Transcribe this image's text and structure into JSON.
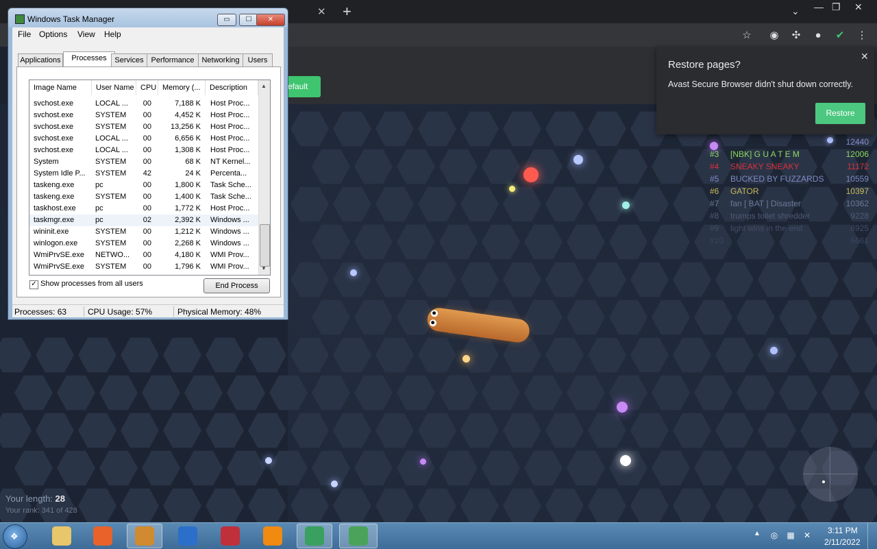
{
  "browser": {
    "tab_close": "✕",
    "new_tab": "+",
    "window_controls": [
      "—",
      "❐",
      "✕"
    ],
    "toolbar_icons": [
      "star-icon",
      "avast-icon",
      "puzzle-icon",
      "profile-icon",
      "shield-check-icon",
      "more-icon"
    ],
    "default_button_label": "efault"
  },
  "restore_popup": {
    "title": "Restore pages?",
    "message": "Avast Secure Browser didn't shut down correctly.",
    "button": "Restore",
    "close": "✕"
  },
  "game": {
    "length_label": "Your length: ",
    "length_value": "28",
    "rank_text": "Your rank: 341 of 428",
    "leaderboard": [
      {
        "rank": "",
        "name": "",
        "score": "12440",
        "color": "#8a8fd0"
      },
      {
        "rank": "#3",
        "name": "[NBK] G U A T E M",
        "score": "12006",
        "color": "#8fd860"
      },
      {
        "rank": "#4",
        "name": "SNEAKY SNEAKY",
        "score": "11172",
        "color": "#d8323c"
      },
      {
        "rank": "#5",
        "name": "BUCKED BY FUZZARDS",
        "score": "10559",
        "color": "#7f8cc4"
      },
      {
        "rank": "#6",
        "name": "GATOR",
        "score": "10397",
        "color": "#c8bc5c"
      },
      {
        "rank": "#7",
        "name": "fan [ BAT ]  Disaster",
        "score": "10362",
        "color": "#6d7898"
      },
      {
        "rank": "#8",
        "name": "trumps toilet shredder",
        "score": "9228",
        "color": "#4f5a76"
      },
      {
        "rank": "#9",
        "name": "light wins in the end",
        "score": "6925",
        "color": "#434c66"
      },
      {
        "rank": "#10",
        "name": "",
        "score": "6661",
        "color": "#3a4460"
      }
    ]
  },
  "task_manager": {
    "title": "Windows Task Manager",
    "window_buttons": [
      "▭",
      "☐",
      "✕"
    ],
    "menu": [
      "File",
      "Options",
      "View",
      "Help"
    ],
    "tabs": [
      "Applications",
      "Processes",
      "Services",
      "Performance",
      "Networking",
      "Users"
    ],
    "active_tab": "Processes",
    "columns": [
      "Image Name",
      "User Name",
      "CPU",
      "Memory (...",
      "Description"
    ],
    "rows": [
      [
        "svchost.exe",
        "LOCAL ...",
        "00",
        "7,188 K",
        "Host Proc..."
      ],
      [
        "svchost.exe",
        "SYSTEM",
        "00",
        "4,452 K",
        "Host Proc..."
      ],
      [
        "svchost.exe",
        "SYSTEM",
        "00",
        "13,256 K",
        "Host Proc..."
      ],
      [
        "svchost.exe",
        "LOCAL ...",
        "00",
        "6,656 K",
        "Host Proc..."
      ],
      [
        "svchost.exe",
        "LOCAL ...",
        "00",
        "1,308 K",
        "Host Proc..."
      ],
      [
        "System",
        "SYSTEM",
        "00",
        "68 K",
        "NT Kernel..."
      ],
      [
        "System Idle P...",
        "SYSTEM",
        "42",
        "24 K",
        "Percenta..."
      ],
      [
        "taskeng.exe",
        "pc",
        "00",
        "1,800 K",
        "Task Sche..."
      ],
      [
        "taskeng.exe",
        "SYSTEM",
        "00",
        "1,400 K",
        "Task Sche..."
      ],
      [
        "taskhost.exe",
        "pc",
        "00",
        "1,772 K",
        "Host Proc..."
      ],
      [
        "taskmgr.exe",
        "pc",
        "02",
        "2,392 K",
        "Windows ..."
      ],
      [
        "wininit.exe",
        "SYSTEM",
        "00",
        "1,212 K",
        "Windows ..."
      ],
      [
        "winlogon.exe",
        "SYSTEM",
        "00",
        "2,268 K",
        "Windows ..."
      ],
      [
        "WmiPrvSE.exe",
        "NETWO...",
        "00",
        "4,180 K",
        "WMI Prov..."
      ],
      [
        "WmiPrvSE.exe",
        "SYSTEM",
        "00",
        "1,796 K",
        "WMI Prov..."
      ]
    ],
    "show_all_label": "Show processes from all users",
    "show_all_checked": "✓",
    "end_process_label": "End Process",
    "status": {
      "processes": "Processes: 63",
      "cpu": "CPU Usage: 57%",
      "memory": "Physical Memory: 48%"
    }
  },
  "taskbar": {
    "apps": [
      {
        "icon": "explorer-icon",
        "color": "#e8c66a"
      },
      {
        "icon": "firefox-icon",
        "color": "#e8622a"
      },
      {
        "icon": "avast-browser-icon",
        "color": "#d08a30"
      },
      {
        "icon": "shield-vpn-icon",
        "color": "#2b6fc8"
      },
      {
        "icon": "screen-recorder-icon",
        "color": "#c0303a"
      },
      {
        "icon": "vlc-icon",
        "color": "#f08a10"
      },
      {
        "icon": "spreadsheet-icon",
        "color": "#3aa060"
      },
      {
        "icon": "task-manager-icon",
        "color": "#4aa35a"
      }
    ],
    "tray_up": "▲",
    "time": "3:11 PM",
    "date": "2/11/2022"
  }
}
